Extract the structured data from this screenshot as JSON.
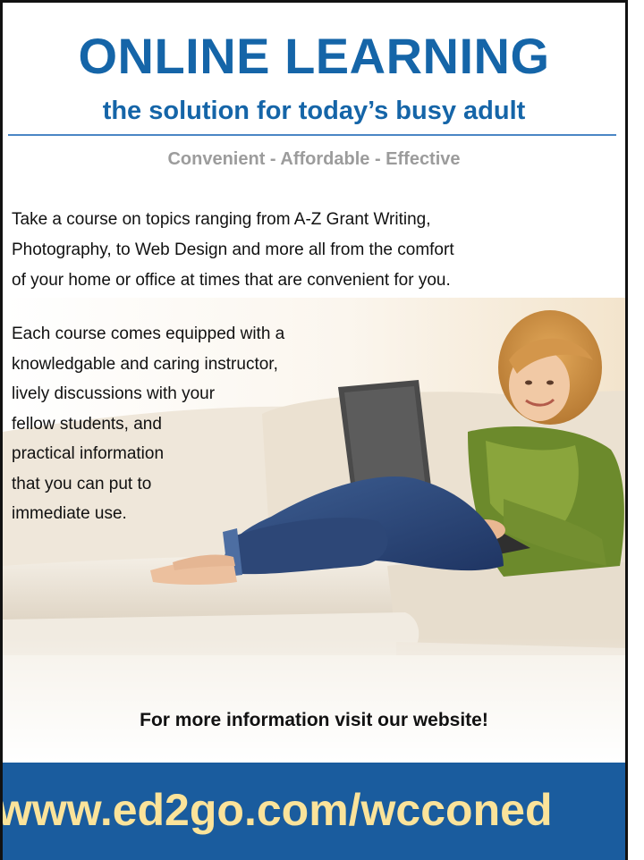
{
  "header": {
    "title": "ONLINE LEARNING",
    "subtitle": "the solution for today’s busy adult",
    "tagline": "Convenient - Affordable - Effective"
  },
  "intro": {
    "lines": [
      "Take a course on topics ranging from A-Z Grant Writing,",
      "Photography, to Web Design and more all from the comfort",
      "of your home or office at times that  are convenient for you."
    ]
  },
  "features": {
    "lines": [
      "Each course comes equipped with a",
      "knowledgable and caring instructor,",
      "lively discussions with your",
      "fellow students, and",
      "practical information",
      "that you can put to",
      "immediate use."
    ]
  },
  "cta": {
    "text": "For more information visit our website!"
  },
  "footer": {
    "url": "www.ed2go.com/wcconed"
  },
  "colors": {
    "brand_blue": "#1565a8",
    "band_blue": "#1a5c9e",
    "url_yellow": "#fbe39a",
    "tagline_gray": "#9c9c9c"
  },
  "photo": {
    "subject": "woman-with-laptop-on-sofa"
  }
}
